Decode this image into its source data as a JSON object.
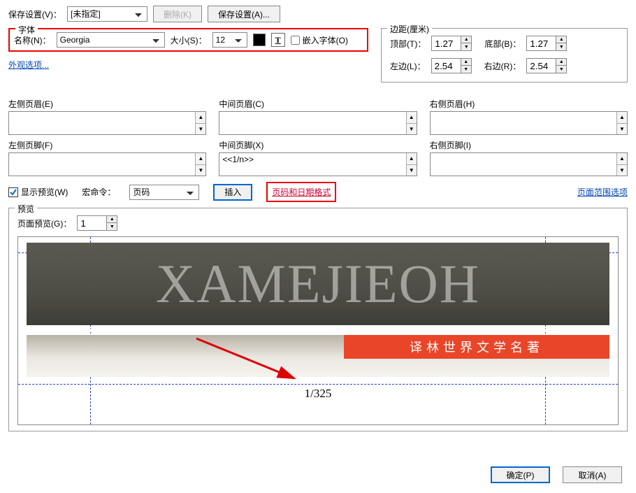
{
  "topbar": {
    "save_settings_label": "保存设置(V)：",
    "save_settings_value": "[未指定]",
    "delete_label": "删除(K)",
    "save_as_label": "保存设置(A)..."
  },
  "font": {
    "legend": "字体",
    "name_label": "名称(N)：",
    "name_value": "Georgia",
    "size_label": "大小(S)：",
    "size_value": "12",
    "embed_label": "嵌入字体(O)"
  },
  "appearance_link": "外观选项...",
  "margins": {
    "legend": "边距(厘米)",
    "top_label": "顶部(T)：",
    "top_value": "1.27",
    "bottom_label": "底部(B)：",
    "bottom_value": "1.27",
    "left_label": "左边(L)：",
    "left_value": "2.54",
    "right_label": "右边(R)：",
    "right_value": "2.54"
  },
  "headers": {
    "left_h": "左侧页眉(E)",
    "center_h": "中间页眉(C)",
    "right_h": "右侧页眉(H)",
    "left_f": "左侧页脚(F)",
    "center_f": "中间页脚(X)",
    "right_f": "右侧页脚(I)",
    "center_f_value": "<<1/n>>"
  },
  "controls": {
    "show_preview": "显示预览(W)",
    "macro_label": "宏命令：",
    "macro_value": "页码",
    "insert": "插入",
    "page_date_format": "页码和日期格式",
    "page_range_opts": "页面范围选项"
  },
  "preview": {
    "legend": "预览",
    "page_preview_label": "页面预览(G)：",
    "page_preview_value": "1",
    "header_text": "XAMEJIEOH",
    "banner_text": "译林世界文学名著",
    "page_number": "1/325"
  },
  "buttons": {
    "ok": "确定(P)",
    "cancel": "取消(A)"
  }
}
